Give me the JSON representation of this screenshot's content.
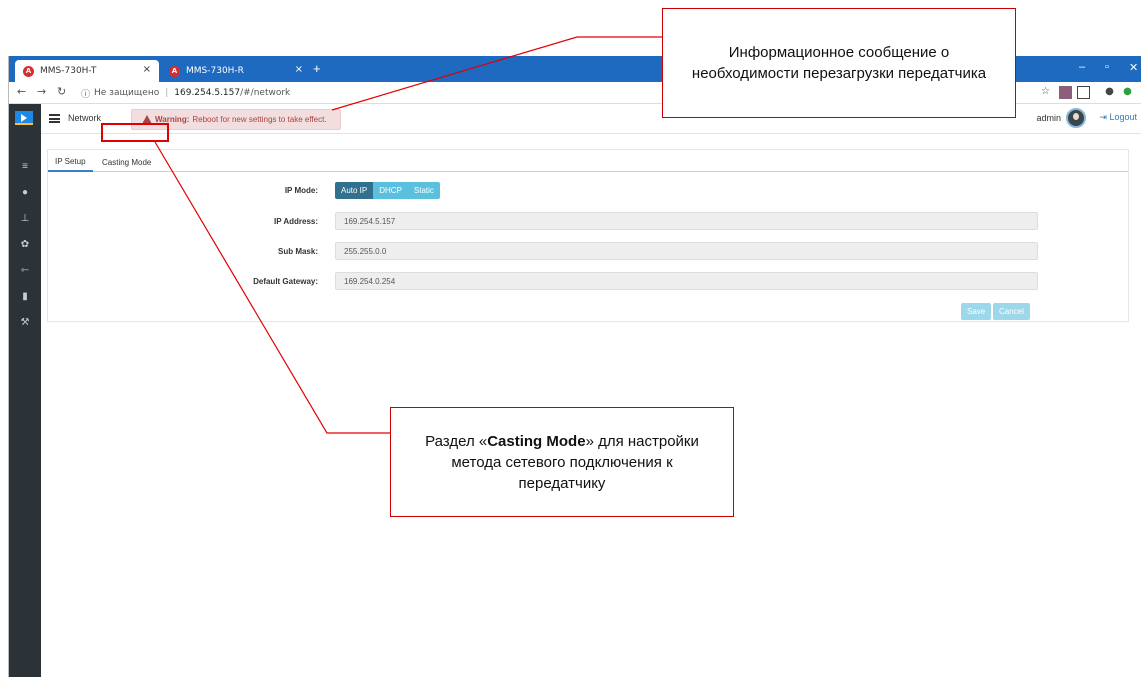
{
  "browser": {
    "tabs": [
      {
        "label": "MMS-730H-T",
        "favicon": "A"
      },
      {
        "label": "MMS-730H-R",
        "favicon": "A"
      }
    ],
    "address": {
      "security": "Не защищено",
      "host": "169.254.5.157",
      "path": "/#/network"
    },
    "window_controls": [
      "–",
      "▫",
      "✕"
    ],
    "close_tab": "×",
    "new_tab": "+"
  },
  "app": {
    "page_title": "Network",
    "warning": {
      "label": "Warning:",
      "text": "Reboot for new settings to take effect."
    },
    "user": "admin",
    "logout": "Logout",
    "sidebar_icons": [
      "dashboard-icon",
      "user-icon",
      "network-icon",
      "gear-icon",
      "usb-icon",
      "storage-icon",
      "wrench-icon"
    ]
  },
  "tabs": [
    "IP Setup",
    "Casting Mode"
  ],
  "form": {
    "ip_mode_label": "IP Mode:",
    "modes": [
      "Auto IP",
      "DHCP",
      "Static"
    ],
    "selected_mode": "Auto IP",
    "ip_address_label": "IP Address:",
    "ip_address": "169.254.5.157",
    "sub_mask_label": "Sub Mask:",
    "sub_mask": "255.255.0.0",
    "gateway_label": "Default Gateway:",
    "gateway": "169.254.0.254",
    "save": "Save",
    "cancel": "Cancel"
  },
  "annotations": {
    "top": "Информационное сообщение о необходимости перезагрузки передатчика",
    "middle_pre": "Раздел «",
    "middle_bold": "Casting Mode",
    "middle_post": "» для настройки метода сетевого подключения к передатчику"
  },
  "colors": {
    "tabbar": "#1e6ac0",
    "sidebar": "#2b3338",
    "warning_bg": "#f2dede",
    "accent": "#5bc0de",
    "annotation": "#e00000"
  }
}
